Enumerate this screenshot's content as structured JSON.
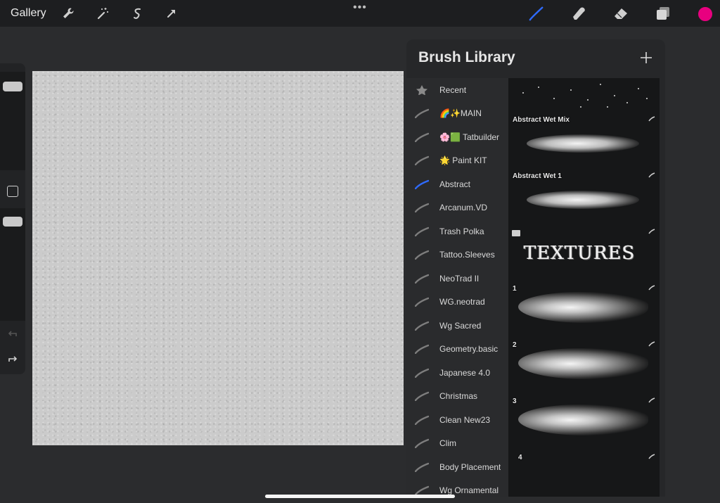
{
  "topbar": {
    "gallery_label": "Gallery",
    "more_label": "•••",
    "icons": [
      "wrench-icon",
      "magic-wand-icon",
      "selection-icon",
      "transform-arrow-icon",
      "brush-icon",
      "smudge-icon",
      "eraser-icon",
      "layers-icon"
    ],
    "active_tool": "brush",
    "accent_color": "#2f6bff",
    "current_color": "#e8007f"
  },
  "sidebar": {
    "icons": [
      "brush-size-slider",
      "modify-button",
      "opacity-slider",
      "undo-arrow-icon",
      "redo-arrow-icon"
    ]
  },
  "brush_library": {
    "title": "Brush Library",
    "add_icon": "plus-icon",
    "sets": [
      {
        "label": "Recent",
        "icon": "star-icon",
        "selected": false
      },
      {
        "label": "🌈✨MAIN",
        "icon": "brush-stroke-icon",
        "selected": false
      },
      {
        "label": "🌸🟩 Tatbuilder",
        "icon": "brush-stroke-icon",
        "selected": false
      },
      {
        "label": "🌟 Paint KIT",
        "icon": "brush-stroke-icon",
        "selected": false
      },
      {
        "label": "Abstract",
        "icon": "brush-stroke-icon",
        "selected": true
      },
      {
        "label": "Arcanum.VD",
        "icon": "brush-stroke-icon",
        "selected": false
      },
      {
        "label": "Trash Polka",
        "icon": "brush-stroke-icon",
        "selected": false
      },
      {
        "label": "Tattoo.Sleeves",
        "icon": "brush-stroke-icon",
        "selected": false
      },
      {
        "label": "NeoTrad II",
        "icon": "brush-stroke-icon",
        "selected": false
      },
      {
        "label": "WG.neotrad",
        "icon": "brush-stroke-icon",
        "selected": false
      },
      {
        "label": "Wg Sacred",
        "icon": "brush-stroke-icon",
        "selected": false
      },
      {
        "label": "Geometry.basic",
        "icon": "brush-stroke-icon",
        "selected": false
      },
      {
        "label": "Japanese 4.0",
        "icon": "brush-stroke-icon",
        "selected": false
      },
      {
        "label": "Christmas",
        "icon": "brush-stroke-icon",
        "selected": false
      },
      {
        "label": "Clean New23",
        "icon": "brush-stroke-icon",
        "selected": false
      },
      {
        "label": "Clim",
        "icon": "brush-stroke-icon",
        "selected": false
      },
      {
        "label": "Body Placement",
        "icon": "brush-stroke-icon",
        "selected": false
      },
      {
        "label": "Wg Ornamental",
        "icon": "brush-stroke-icon",
        "selected": false
      }
    ],
    "brushes": [
      {
        "name": "",
        "preview": "splatter"
      },
      {
        "name": "Abstract Wet Mix",
        "preview": "wet"
      },
      {
        "name": "Abstract Wet 1",
        "preview": "wet"
      },
      {
        "name": "TEXTURES",
        "preview": "text"
      },
      {
        "name": "1",
        "preview": "paint"
      },
      {
        "name": "2",
        "preview": "paint"
      },
      {
        "name": "3",
        "preview": "paint"
      },
      {
        "name": "4",
        "preview": "paint"
      }
    ]
  }
}
